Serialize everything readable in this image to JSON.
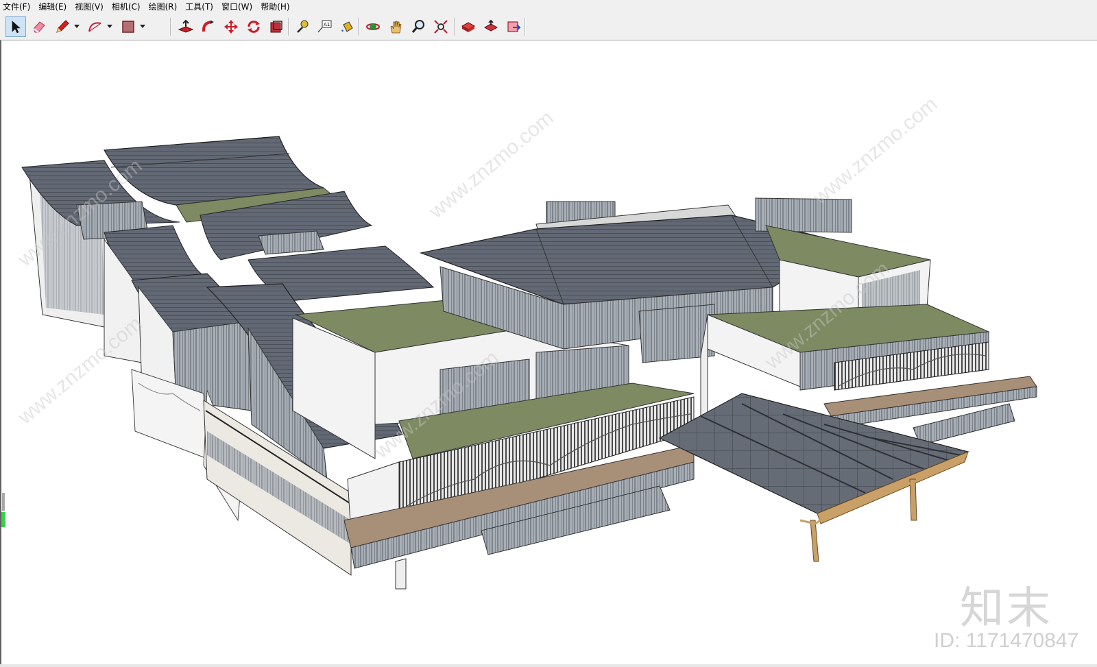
{
  "menu": [
    "文件(F)",
    "编辑(E)",
    "视图(V)",
    "相机(C)",
    "绘图(R)",
    "工具(T)",
    "窗口(W)",
    "帮助(H)"
  ],
  "toolbar": {
    "groups": [
      [
        "select-tool",
        "eraser-tool",
        "pencil-tool",
        "arc-tool",
        "rectangle-tool"
      ],
      [
        "push-pull-tool",
        "follow-me-tool",
        "move-tool",
        "rotate-tool",
        "offset-tool"
      ],
      [
        "tape-measure-tool",
        "text-tool",
        "paint-bucket-tool"
      ],
      [
        "orbit-tool",
        "pan-tool",
        "zoom-tool",
        "zoom-extents-tool"
      ],
      [
        "warehouse-tool",
        "share-model-tool",
        "extension-tool"
      ]
    ],
    "text_tool_glyph": "A1"
  },
  "watermark": {
    "brand": "知末",
    "id": "ID: 1171470847",
    "diag": "www.znzmo.com"
  },
  "colors": {
    "roof": "#5f6570",
    "roof_dark": "#4a4f58",
    "green_roof": "#7a8660",
    "wall": "#f2f2f2",
    "glass": "#9aa3ad",
    "deck": "#a88f78",
    "timber": "#c8a068"
  }
}
